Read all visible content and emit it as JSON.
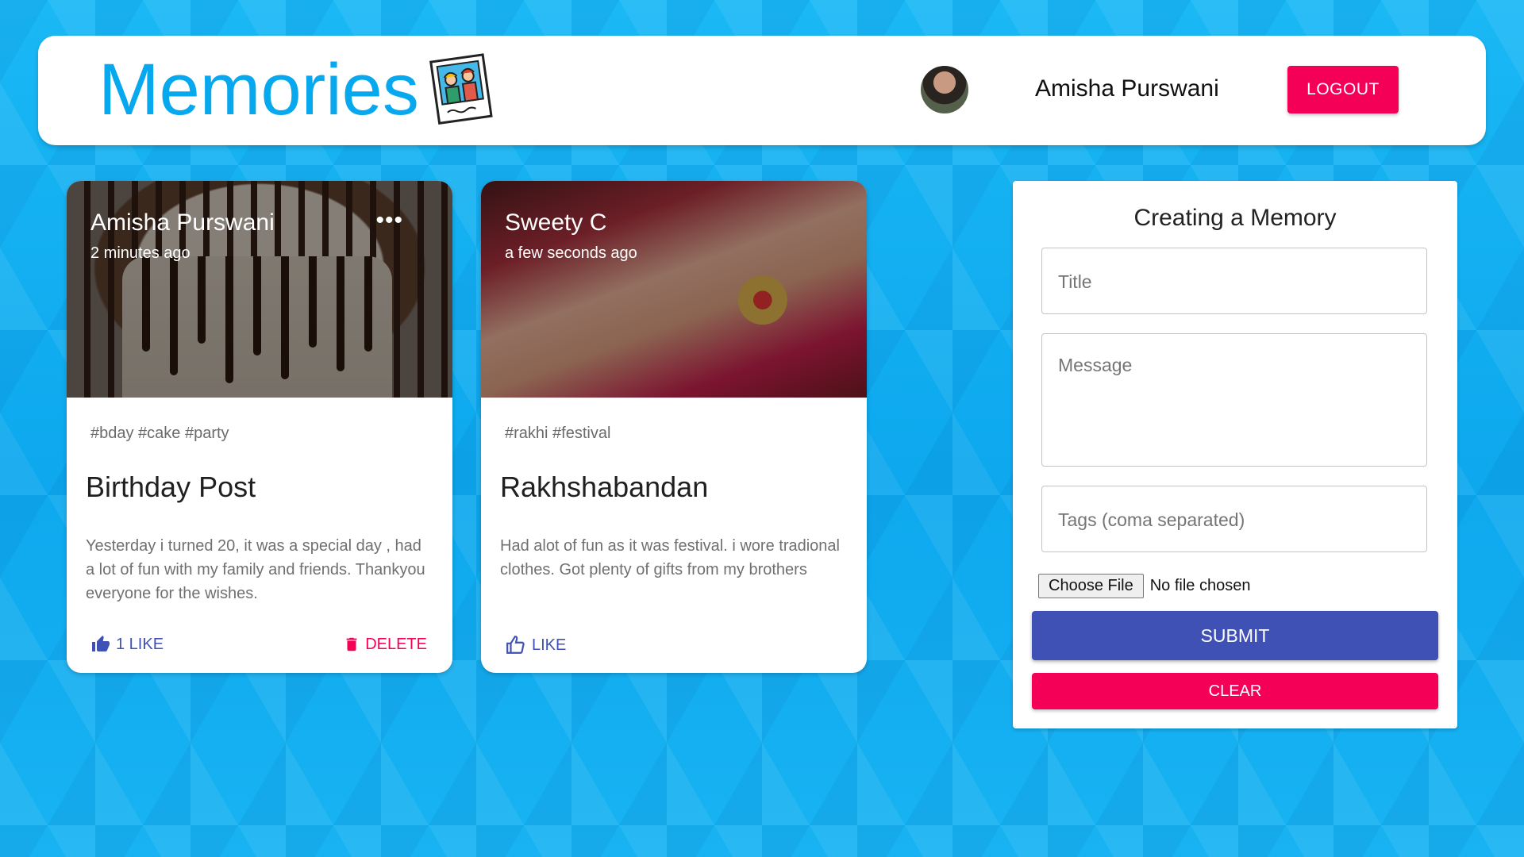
{
  "header": {
    "brand": "Memories",
    "brand_icon": "photo-memories-icon",
    "user_name": "Amisha Purswani",
    "logout_label": "LOGOUT"
  },
  "posts": [
    {
      "author": "Amisha Purswani",
      "time": "2 minutes ago",
      "image": "birthday-cake-photo",
      "tags": "#bday #cake #party",
      "title": "Birthday Post",
      "message": "Yesterday i turned 20, it was a special day , had a lot of fun with my family and friends. Thankyou everyone for the wishes.",
      "like_label": "1 LIKE",
      "delete_label": "DELETE"
    },
    {
      "author": "Sweety C",
      "time": "a few seconds ago",
      "image": "rakhi-wrist-photo",
      "tags": "#rakhi #festival",
      "title": "Rakhshabandan",
      "message": "Had alot of fun as it was festival. i wore tradional clothes. Got plenty of gifts from my brothers",
      "like_label": "LIKE"
    }
  ],
  "form": {
    "heading": "Creating a Memory",
    "title_placeholder": "Title",
    "message_placeholder": "Message",
    "tags_placeholder": "Tags (coma separated)",
    "file_button": "Choose File",
    "file_status": "No file chosen",
    "submit_label": "SUBMIT",
    "clear_label": "CLEAR"
  },
  "colors": {
    "brand": "#08a8ee",
    "primary": "#3f51b5",
    "secondary": "#f50057",
    "background": "#12b5f2"
  }
}
